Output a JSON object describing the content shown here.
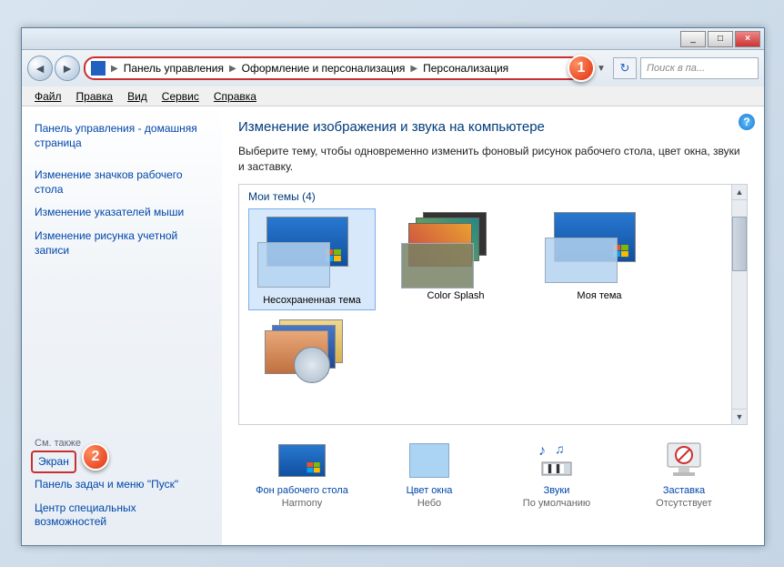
{
  "titlebar": {
    "min": "_",
    "max": "□",
    "close": "×"
  },
  "breadcrumb": {
    "root_icon": "control-panel-icon",
    "items": [
      "Панель управления",
      "Оформление и персонализация",
      "Персонализация"
    ]
  },
  "search": {
    "placeholder": "Поиск в па..."
  },
  "annotations": {
    "a1": "1",
    "a2": "2"
  },
  "menubar": [
    "Файл",
    "Правка",
    "Вид",
    "Сервис",
    "Справка"
  ],
  "sidebar": {
    "links": [
      "Панель управления - домашняя страница",
      "Изменение значков рабочего стола",
      "Изменение указателей мыши",
      "Изменение рисунка учетной записи"
    ],
    "see_also_heading": "См. также",
    "see_also": [
      "Экран",
      "Панель задач и меню \"Пуск\"",
      "Центр специальных возможностей"
    ]
  },
  "main": {
    "title": "Изменение изображения и звука на компьютере",
    "desc": "Выберите тему, чтобы одновременно изменить фоновый рисунок рабочего стола, цвет окна, звуки и заставку.",
    "themes_heading": "Мои темы (4)",
    "themes": [
      "Несохраненная тема",
      "Color Splash",
      "Моя тема"
    ],
    "bottom": [
      {
        "link": "Фон рабочего стола",
        "sub": "Harmony"
      },
      {
        "link": "Цвет окна",
        "sub": "Небо"
      },
      {
        "link": "Звуки",
        "sub": "По умолчанию"
      },
      {
        "link": "Заставка",
        "sub": "Отсутствует"
      }
    ]
  }
}
